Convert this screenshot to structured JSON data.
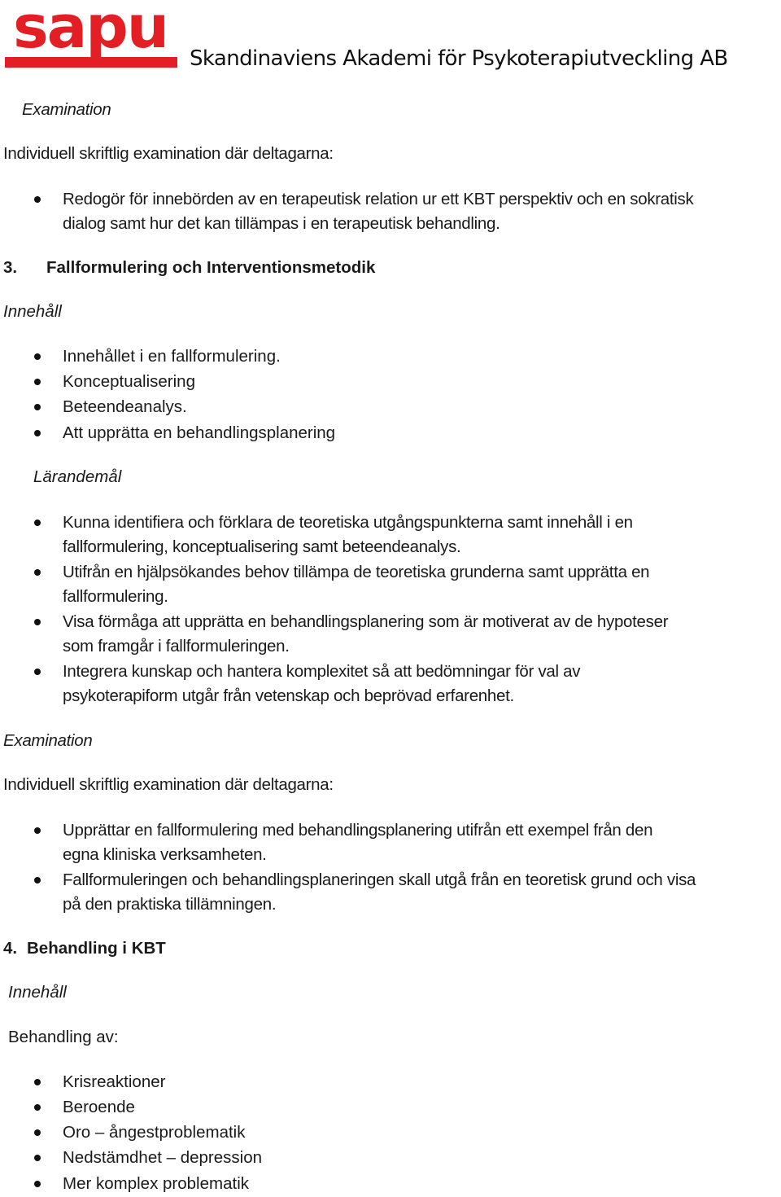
{
  "header": {
    "logo_text": "sapu",
    "brand_color": "#e31e24",
    "organization": "Skandinaviens Akademi för Psykoterapiutveckling AB"
  },
  "section2_exam": {
    "heading": "Examination",
    "intro": "Individuell skriftlig examination där deltagarna:",
    "bullets": [
      {
        "line1": "Redogör för innebörden av en terapeutisk relation ur ett KBT perspektiv och en sokratisk",
        "line2": "dialog samt hur det kan tillämpas i en terapeutisk behandling."
      }
    ]
  },
  "section3": {
    "number": "3.",
    "title": "Fallformulering och Interventionsmetodik",
    "content_heading": "Innehåll",
    "content_items": [
      "Innehållet i en fallformulering.",
      "Konceptualisering",
      "Beteendeanalys.",
      "Att upprätta en behandlingsplanering"
    ],
    "goals_heading": "Lärandemål",
    "goals": [
      {
        "line1": "Kunna identifiera och förklara de teoretiska utgångspunkterna samt innehåll i en",
        "line2": "fallformulering, konceptualisering samt beteendeanalys."
      },
      {
        "line1": "Utifrån en hjälpsökandes behov tillämpa de teoretiska grunderna samt upprätta en",
        "line2": "fallformulering."
      },
      {
        "line1": "Visa förmåga att upprätta en behandlingsplanering som är motiverat av de hypoteser",
        "line2": "som framgår i fallformuleringen."
      },
      {
        "line1": "Integrera kunskap och hantera komplexitet så att bedömningar för val av",
        "line2": "psykoterapiform utgår från vetenskap och beprövad erfarenhet."
      }
    ],
    "exam_heading": "Examination",
    "exam_intro": "Individuell skriftlig examination där deltagarna:",
    "exam_items": [
      {
        "line1": "Upprättar en fallformulering med behandlingsplanering utifrån ett exempel från den",
        "line2": "egna kliniska verksamheten."
      },
      {
        "line1": "Fallformuleringen och behandlingsplaneringen skall utgå från en teoretisk grund och visa",
        "line2": "på den praktiska tillämningen."
      }
    ]
  },
  "section4": {
    "number": "4.",
    "title": "Behandling i KBT",
    "content_heading": "Innehåll",
    "intro": "Behandling av:",
    "items": [
      "Krisreaktioner",
      "Beroende",
      "Oro – ångestproblematik",
      "Nedstämdhet – depression",
      "Mer komplex problematik"
    ]
  }
}
